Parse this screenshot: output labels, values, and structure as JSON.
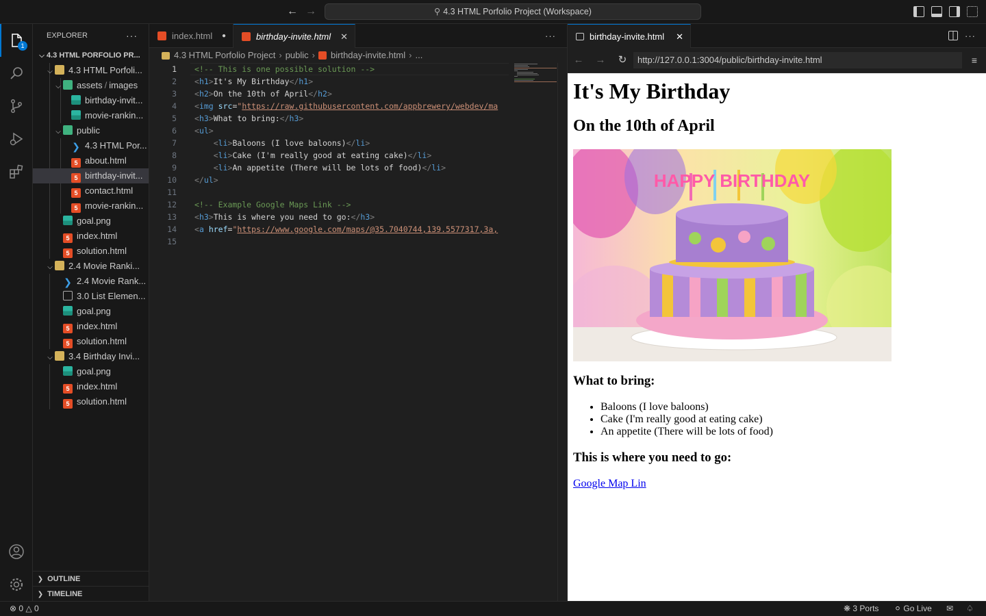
{
  "titlebar": {
    "command_center": "4.3 HTML Porfolio Project (Workspace)"
  },
  "activity": {
    "explorer_badge": "1"
  },
  "sidebar": {
    "title": "EXPLORER",
    "tree": [
      {
        "label": "4.3 HTML PORFOLIO PR...",
        "kind": "root"
      },
      {
        "label": "4.3 HTML Porfoli...",
        "kind": "folder"
      },
      {
        "label": "assets",
        "label2": "images",
        "kind": "folder-green"
      },
      {
        "label": "birthday-invit...",
        "kind": "img"
      },
      {
        "label": "movie-rankin...",
        "kind": "img"
      },
      {
        "label": "public",
        "kind": "folder-green"
      },
      {
        "label": "4.3 HTML Por...",
        "kind": "vscode"
      },
      {
        "label": "about.html",
        "kind": "html"
      },
      {
        "label": "birthday-invit...",
        "kind": "html"
      },
      {
        "label": "contact.html",
        "kind": "html"
      },
      {
        "label": "movie-rankin...",
        "kind": "html"
      },
      {
        "label": "goal.png",
        "kind": "img"
      },
      {
        "label": "index.html",
        "kind": "html"
      },
      {
        "label": "solution.html",
        "kind": "html"
      },
      {
        "label": "2.4 Movie Ranki...",
        "kind": "folder"
      },
      {
        "label": "2.4 Movie Rank...",
        "kind": "vscode"
      },
      {
        "label": "3.0 List Elemen...",
        "kind": "file"
      },
      {
        "label": "goal.png",
        "kind": "img"
      },
      {
        "label": "index.html",
        "kind": "html"
      },
      {
        "label": "solution.html",
        "kind": "html"
      },
      {
        "label": "3.4 Birthday Invi...",
        "kind": "folder"
      },
      {
        "label": "goal.png",
        "kind": "img"
      },
      {
        "label": "index.html",
        "kind": "html"
      },
      {
        "label": "solution.html",
        "kind": "html"
      }
    ],
    "outline": "OUTLINE",
    "timeline": "TIMELINE"
  },
  "editor": {
    "tabs": [
      {
        "label": "index.html",
        "modified": true
      },
      {
        "label": "birthday-invite.html",
        "active": true
      }
    ],
    "breadcrumb": [
      "4.3 HTML Porfolio Project",
      "public",
      "birthday-invite.html",
      "..."
    ],
    "lines": [
      {
        "n": "1",
        "parts": [
          [
            "c-comment",
            "<!-- This is one possible solution -->"
          ]
        ]
      },
      {
        "n": "2",
        "parts": [
          [
            "c-bracket",
            "<"
          ],
          [
            "c-tag",
            "h1"
          ],
          [
            "c-bracket",
            ">"
          ],
          [
            "",
            "It's My Birthday"
          ],
          [
            "c-bracket",
            "</"
          ],
          [
            "c-tag",
            "h1"
          ],
          [
            "c-bracket",
            ">"
          ]
        ]
      },
      {
        "n": "3",
        "parts": [
          [
            "c-bracket",
            "<"
          ],
          [
            "c-tag",
            "h2"
          ],
          [
            "c-bracket",
            ">"
          ],
          [
            "",
            "On the 10th of April"
          ],
          [
            "c-bracket",
            "</"
          ],
          [
            "c-tag",
            "h2"
          ],
          [
            "c-bracket",
            ">"
          ]
        ]
      },
      {
        "n": "4",
        "parts": [
          [
            "c-bracket",
            "<"
          ],
          [
            "c-tag",
            "img"
          ],
          [
            "",
            " "
          ],
          [
            "c-attr",
            "src"
          ],
          [
            "",
            "="
          ],
          [
            "c-strq",
            "\""
          ],
          [
            "c-str",
            "https://raw.githubusercontent.com/appbrewery/webdev/ma"
          ]
        ]
      },
      {
        "n": "5",
        "parts": [
          [
            "c-bracket",
            "<"
          ],
          [
            "c-tag",
            "h3"
          ],
          [
            "c-bracket",
            ">"
          ],
          [
            "",
            "What to bring:"
          ],
          [
            "c-bracket",
            "</"
          ],
          [
            "c-tag",
            "h3"
          ],
          [
            "c-bracket",
            ">"
          ]
        ]
      },
      {
        "n": "6",
        "parts": [
          [
            "c-bracket",
            "<"
          ],
          [
            "c-tag",
            "ul"
          ],
          [
            "c-bracket",
            ">"
          ]
        ]
      },
      {
        "n": "7",
        "parts": [
          [
            "",
            "    "
          ],
          [
            "c-bracket",
            "<"
          ],
          [
            "c-tag",
            "li"
          ],
          [
            "c-bracket",
            ">"
          ],
          [
            "",
            "Baloons (I love baloons)"
          ],
          [
            "c-bracket",
            "</"
          ],
          [
            "c-tag",
            "li"
          ],
          [
            "c-bracket",
            ">"
          ]
        ]
      },
      {
        "n": "8",
        "parts": [
          [
            "",
            "    "
          ],
          [
            "c-bracket",
            "<"
          ],
          [
            "c-tag",
            "li"
          ],
          [
            "c-bracket",
            ">"
          ],
          [
            "",
            "Cake (I'm really good at eating cake)"
          ],
          [
            "c-bracket",
            "</"
          ],
          [
            "c-tag",
            "li"
          ],
          [
            "c-bracket",
            ">"
          ]
        ]
      },
      {
        "n": "9",
        "parts": [
          [
            "",
            "    "
          ],
          [
            "c-bracket",
            "<"
          ],
          [
            "c-tag",
            "li"
          ],
          [
            "c-bracket",
            ">"
          ],
          [
            "",
            "An appetite (There will be lots of food)"
          ],
          [
            "c-bracket",
            "</"
          ],
          [
            "c-tag",
            "li"
          ],
          [
            "c-bracket",
            ">"
          ]
        ]
      },
      {
        "n": "10",
        "parts": [
          [
            "c-bracket",
            "</"
          ],
          [
            "c-tag",
            "ul"
          ],
          [
            "c-bracket",
            ">"
          ]
        ]
      },
      {
        "n": "11",
        "parts": []
      },
      {
        "n": "12",
        "parts": [
          [
            "c-comment",
            "<!-- Example Google Maps Link -->"
          ]
        ]
      },
      {
        "n": "13",
        "parts": [
          [
            "c-bracket",
            "<"
          ],
          [
            "c-tag",
            "h3"
          ],
          [
            "c-bracket",
            ">"
          ],
          [
            "",
            "This is where you need to go:"
          ],
          [
            "c-bracket",
            "</"
          ],
          [
            "c-tag",
            "h3"
          ],
          [
            "c-bracket",
            ">"
          ]
        ]
      },
      {
        "n": "14",
        "parts": [
          [
            "c-bracket",
            "<"
          ],
          [
            "c-tag",
            "a"
          ],
          [
            "",
            " "
          ],
          [
            "c-attr",
            "href"
          ],
          [
            "",
            "="
          ],
          [
            "c-strq",
            "\""
          ],
          [
            "c-str",
            "https://www.google.com/maps/@35.7040744,139.5577317,3a,"
          ]
        ]
      },
      {
        "n": "15",
        "parts": []
      }
    ]
  },
  "preview": {
    "tab_label": "birthday-invite.html",
    "url": "http://127.0.0.1:3004/public/birthday-invite.html",
    "h1": "It's My Birthday",
    "h2": "On the 10th of April",
    "image_text": "HAPPY BIRTHDAY",
    "h3_bring": "What to bring:",
    "items": [
      "Baloons (I love baloons)",
      "Cake (I'm really good at eating cake)",
      "An appetite (There will be lots of food)"
    ],
    "h3_go": "This is where you need to go:",
    "link": "Google Map Lin"
  },
  "status": {
    "errors": "0",
    "warnings": "0",
    "ports": "3 Ports",
    "go_live": "Go Live"
  },
  "colors": {
    "accent": "#0078d4",
    "html_icon": "#e44d26",
    "background": "#181818",
    "editor_bg": "#1f1f1f"
  }
}
